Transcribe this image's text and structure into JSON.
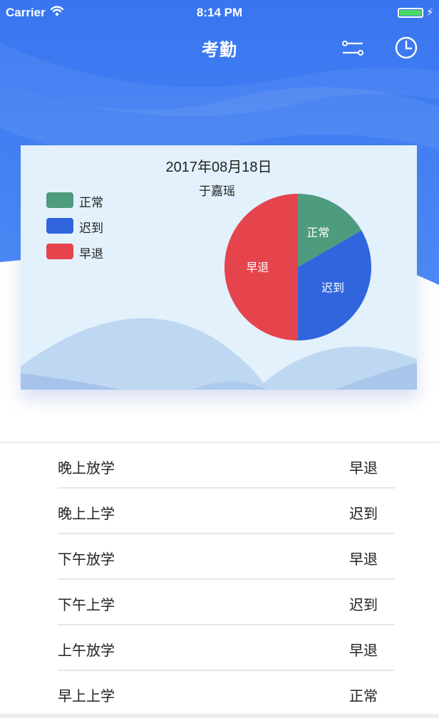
{
  "status_bar": {
    "carrier": "Carrier",
    "time": "8:14 PM",
    "battery_level": 1.0
  },
  "nav": {
    "title": "考勤",
    "icons": [
      "filter-icon",
      "clock-icon"
    ]
  },
  "card": {
    "date": "2017年08月18日",
    "person": "于嘉瑶",
    "legend": [
      {
        "label": "正常",
        "color": "#4e9b7d"
      },
      {
        "label": "迟到",
        "color": "#3065de"
      },
      {
        "label": "早退",
        "color": "#e5444d"
      }
    ]
  },
  "chart_data": {
    "type": "pie",
    "title": "",
    "slices": [
      {
        "label": "正常",
        "value": 1,
        "color": "#4e9b7d"
      },
      {
        "label": "迟到",
        "value": 2,
        "color": "#3065de"
      },
      {
        "label": "早退",
        "value": 3,
        "color": "#e5444d"
      }
    ]
  },
  "records": [
    {
      "label": "晚上放学",
      "status": "早退"
    },
    {
      "label": "晚上上学",
      "status": "迟到"
    },
    {
      "label": "下午放学",
      "status": "早退"
    },
    {
      "label": "下午上学",
      "status": "迟到"
    },
    {
      "label": "上午放学",
      "status": "早退"
    },
    {
      "label": "早上上学",
      "status": "正常"
    }
  ],
  "colors": {
    "header_blue": "#3a78f0",
    "card_bg": "#e2f1fb",
    "accent": "#2f6ee6"
  }
}
